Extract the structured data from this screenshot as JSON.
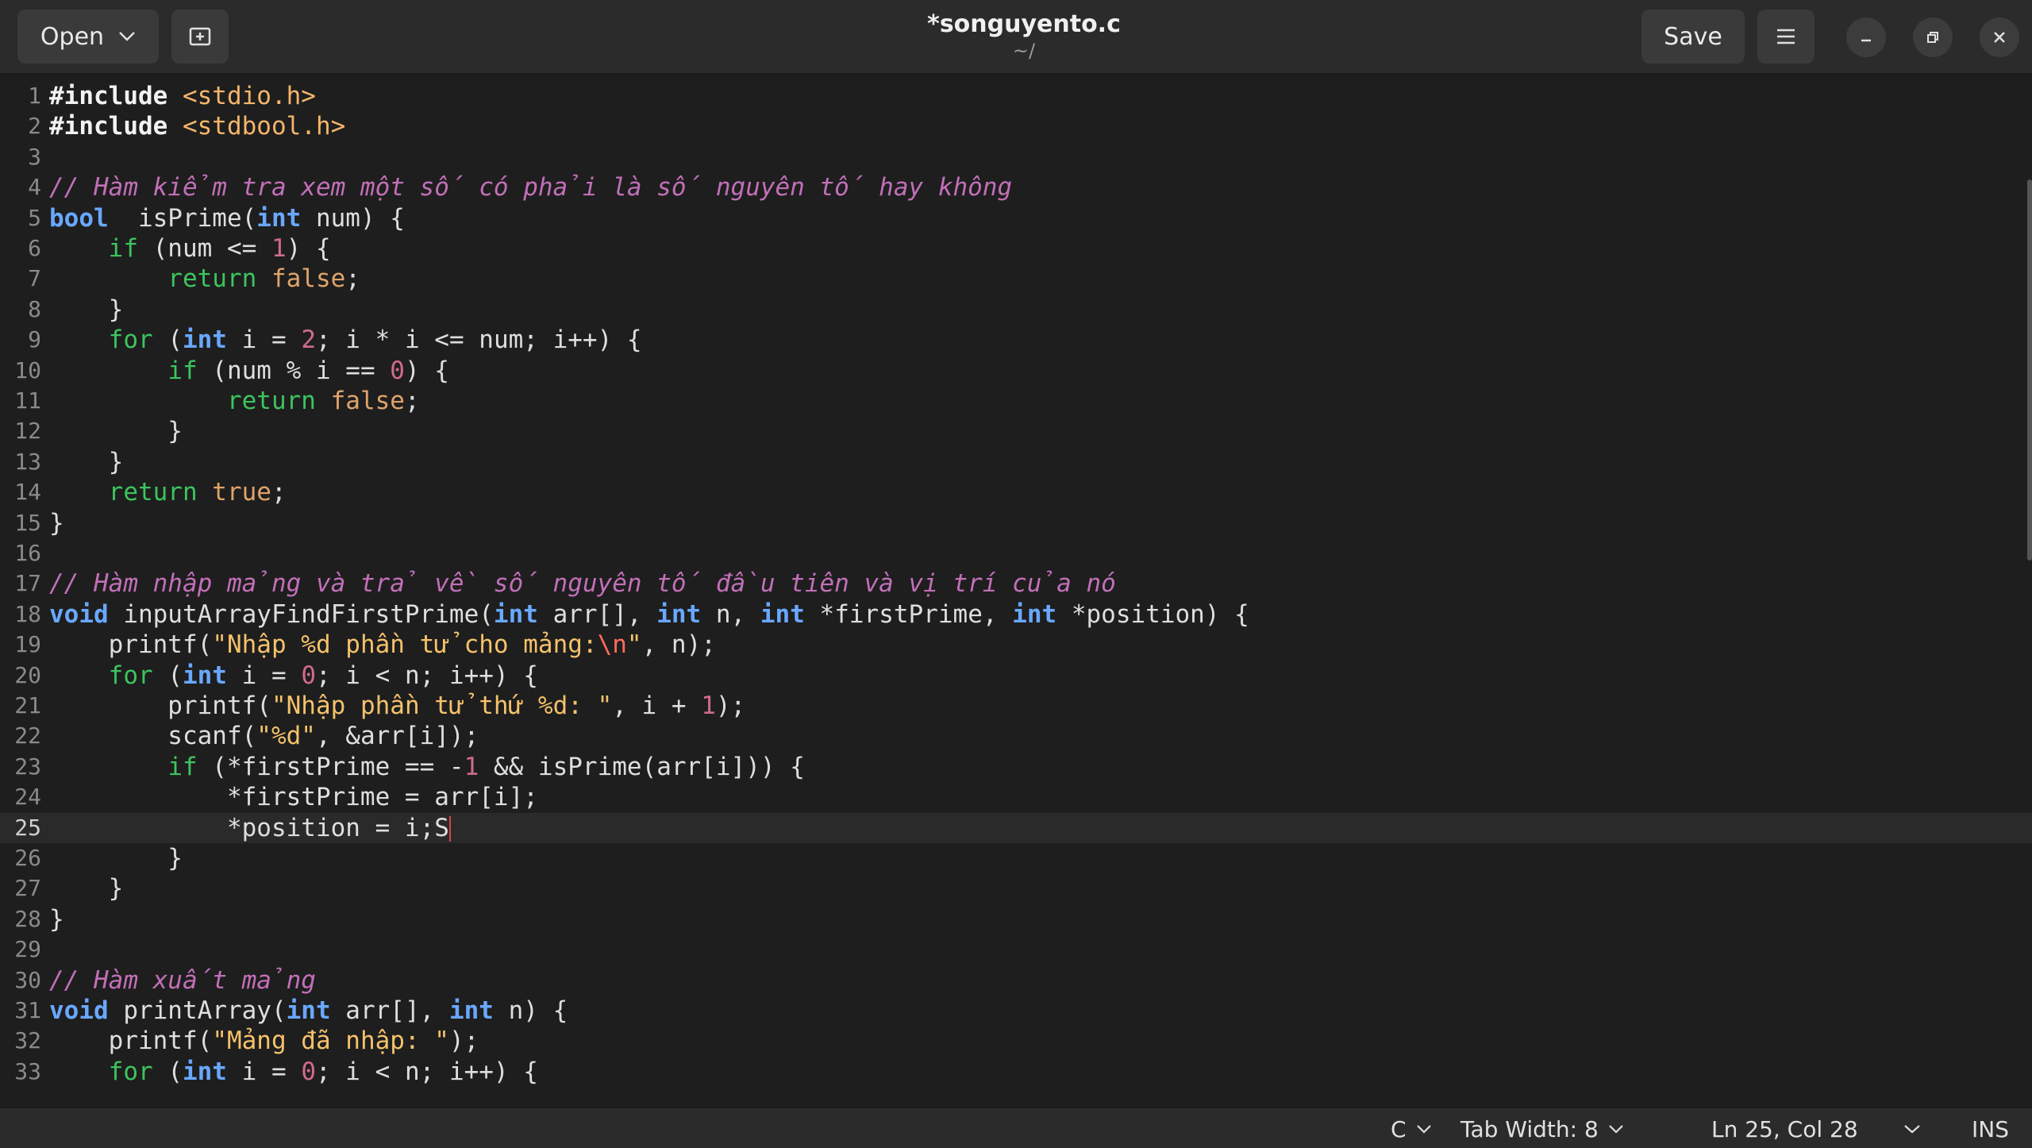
{
  "header": {
    "open_label": "Open",
    "title": "*songuyento.c",
    "subtitle": "~/",
    "save_label": "Save"
  },
  "editor": {
    "current_line": 25,
    "lines": [
      {
        "n": "1",
        "t": [
          [
            "pp",
            "#include "
          ],
          [
            "hd",
            "<stdio.h>"
          ]
        ]
      },
      {
        "n": "2",
        "t": [
          [
            "pp",
            "#include "
          ],
          [
            "hd",
            "<stdbool.h>"
          ]
        ]
      },
      {
        "n": "3",
        "t": []
      },
      {
        "n": "4",
        "t": [
          [
            "cm",
            "// Hàm kiểm tra xem một số có phải là số nguyên tố hay không"
          ]
        ]
      },
      {
        "n": "5",
        "t": [
          [
            "ty",
            "bool"
          ],
          [
            "",
            "  isPrime("
          ],
          [
            "ty",
            "int"
          ],
          [
            "",
            " num) {"
          ]
        ]
      },
      {
        "n": "6",
        "t": [
          [
            "",
            "    "
          ],
          [
            "kw",
            "if"
          ],
          [
            "",
            " (num <= "
          ],
          [
            "nm",
            "1"
          ],
          [
            "",
            ") {"
          ]
        ]
      },
      {
        "n": "7",
        "t": [
          [
            "",
            "        "
          ],
          [
            "kw",
            "return"
          ],
          [
            "bl",
            " false"
          ],
          [
            "",
            ";"
          ]
        ]
      },
      {
        "n": "8",
        "t": [
          [
            "",
            "    }"
          ]
        ]
      },
      {
        "n": "9",
        "t": [
          [
            "",
            "    "
          ],
          [
            "kw",
            "for"
          ],
          [
            "",
            " ("
          ],
          [
            "ty",
            "int"
          ],
          [
            "",
            " i = "
          ],
          [
            "nm",
            "2"
          ],
          [
            "",
            "; i * i <= num; i++) {"
          ]
        ]
      },
      {
        "n": "10",
        "t": [
          [
            "",
            "        "
          ],
          [
            "kw",
            "if"
          ],
          [
            "",
            " (num % i == "
          ],
          [
            "nm",
            "0"
          ],
          [
            "",
            ") {"
          ]
        ]
      },
      {
        "n": "11",
        "t": [
          [
            "",
            "            "
          ],
          [
            "kw",
            "return"
          ],
          [
            "bl",
            " false"
          ],
          [
            "",
            ";"
          ]
        ]
      },
      {
        "n": "12",
        "t": [
          [
            "",
            "        }"
          ]
        ]
      },
      {
        "n": "13",
        "t": [
          [
            "",
            "    }"
          ]
        ]
      },
      {
        "n": "14",
        "t": [
          [
            "",
            "    "
          ],
          [
            "kw",
            "return"
          ],
          [
            "bl",
            " true"
          ],
          [
            "",
            ";"
          ]
        ]
      },
      {
        "n": "15",
        "t": [
          [
            "",
            "}"
          ]
        ]
      },
      {
        "n": "16",
        "t": []
      },
      {
        "n": "17",
        "t": [
          [
            "cm",
            "// Hàm nhập mảng và trả về số nguyên tố đầu tiên và vị trí của nó"
          ]
        ]
      },
      {
        "n": "18",
        "t": [
          [
            "ty",
            "void"
          ],
          [
            "",
            " inputArrayFindFirstPrime("
          ],
          [
            "ty",
            "int"
          ],
          [
            "",
            " arr[], "
          ],
          [
            "ty",
            "int"
          ],
          [
            "",
            " n, "
          ],
          [
            "ty",
            "int"
          ],
          [
            "",
            " *firstPrime, "
          ],
          [
            "ty",
            "int"
          ],
          [
            "",
            " *position) {"
          ]
        ]
      },
      {
        "n": "19",
        "t": [
          [
            "",
            "    printf("
          ],
          [
            "st",
            "\"Nhập %d phần tử cho mảng:"
          ],
          [
            "es",
            "\\n"
          ],
          [
            "st",
            "\""
          ],
          [
            "",
            ", n);"
          ]
        ]
      },
      {
        "n": "20",
        "t": [
          [
            "",
            "    "
          ],
          [
            "kw",
            "for"
          ],
          [
            "",
            " ("
          ],
          [
            "ty",
            "int"
          ],
          [
            "",
            " i = "
          ],
          [
            "nm",
            "0"
          ],
          [
            "",
            "; i < n; i++) {"
          ]
        ]
      },
      {
        "n": "21",
        "t": [
          [
            "",
            "        printf("
          ],
          [
            "st",
            "\"Nhập phần tử thứ %d: \""
          ],
          [
            "",
            ", i + "
          ],
          [
            "nm",
            "1"
          ],
          [
            "",
            ");"
          ]
        ]
      },
      {
        "n": "22",
        "t": [
          [
            "",
            "        scanf("
          ],
          [
            "st",
            "\"%d\""
          ],
          [
            "",
            ", &arr[i]);"
          ]
        ]
      },
      {
        "n": "23",
        "t": [
          [
            "",
            "        "
          ],
          [
            "kw",
            "if"
          ],
          [
            "",
            " (*firstPrime == -"
          ],
          [
            "nm",
            "1"
          ],
          [
            "",
            " && isPrime(arr[i])) {"
          ]
        ]
      },
      {
        "n": "24",
        "t": [
          [
            "",
            "            *firstPrime = arr[i];"
          ]
        ]
      },
      {
        "n": "25",
        "t": [
          [
            "",
            "            *position = i;S"
          ]
        ]
      },
      {
        "n": "26",
        "t": [
          [
            "",
            "        }"
          ]
        ]
      },
      {
        "n": "27",
        "t": [
          [
            "",
            "    }"
          ]
        ]
      },
      {
        "n": "28",
        "t": [
          [
            "",
            "}"
          ]
        ]
      },
      {
        "n": "29",
        "t": []
      },
      {
        "n": "30",
        "t": [
          [
            "cm",
            "// Hàm xuất mảng"
          ]
        ]
      },
      {
        "n": "31",
        "t": [
          [
            "ty",
            "void"
          ],
          [
            "",
            " printArray("
          ],
          [
            "ty",
            "int"
          ],
          [
            "",
            " arr[], "
          ],
          [
            "ty",
            "int"
          ],
          [
            "",
            " n) {"
          ]
        ]
      },
      {
        "n": "32",
        "t": [
          [
            "",
            "    printf("
          ],
          [
            "st",
            "\"Mảng đã nhập: \""
          ],
          [
            "",
            ");"
          ]
        ]
      },
      {
        "n": "33",
        "t": [
          [
            "",
            "    "
          ],
          [
            "kw",
            "for"
          ],
          [
            "",
            " ("
          ],
          [
            "ty",
            "int"
          ],
          [
            "",
            " i = "
          ],
          [
            "nm",
            "0"
          ],
          [
            "",
            "; i < n; i++) {"
          ]
        ]
      }
    ]
  },
  "status": {
    "language": "C",
    "tab_width": "Tab Width: 8",
    "position": "Ln 25, Col 28",
    "mode": "INS"
  }
}
